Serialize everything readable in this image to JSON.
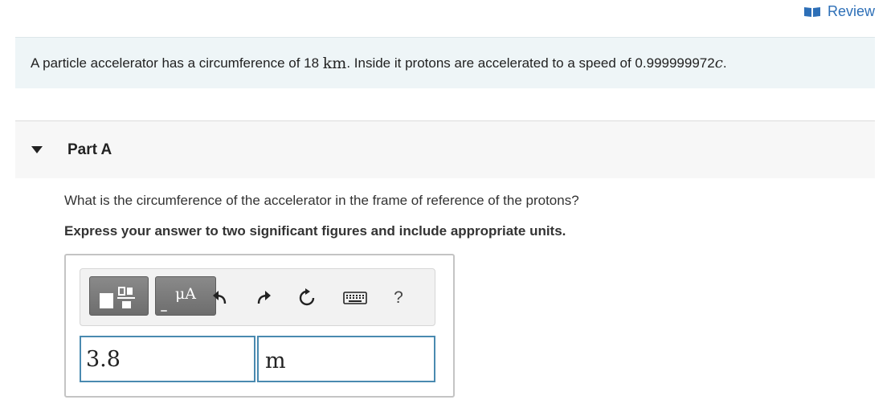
{
  "header": {
    "review_label": "Review"
  },
  "problem": {
    "text_1": "A particle accelerator has a circumference of 18 ",
    "unit_km": "km",
    "text_2": ". Inside it protons are accelerated to a speed of 0.999999972",
    "var_c": "c",
    "text_3": "."
  },
  "part": {
    "title": "Part A",
    "question": "What is the circumference of the accelerator in the frame of reference of the protons?",
    "instruction": "Express your answer to two significant figures and include appropriate units."
  },
  "toolbar": {
    "units_label": "μA",
    "help_label": "?"
  },
  "answer": {
    "value": "3.8",
    "unit": "m"
  },
  "colors": {
    "link": "#2d6fb7",
    "problem_bg": "#eef5f7",
    "input_border": "#4a8ab0"
  }
}
